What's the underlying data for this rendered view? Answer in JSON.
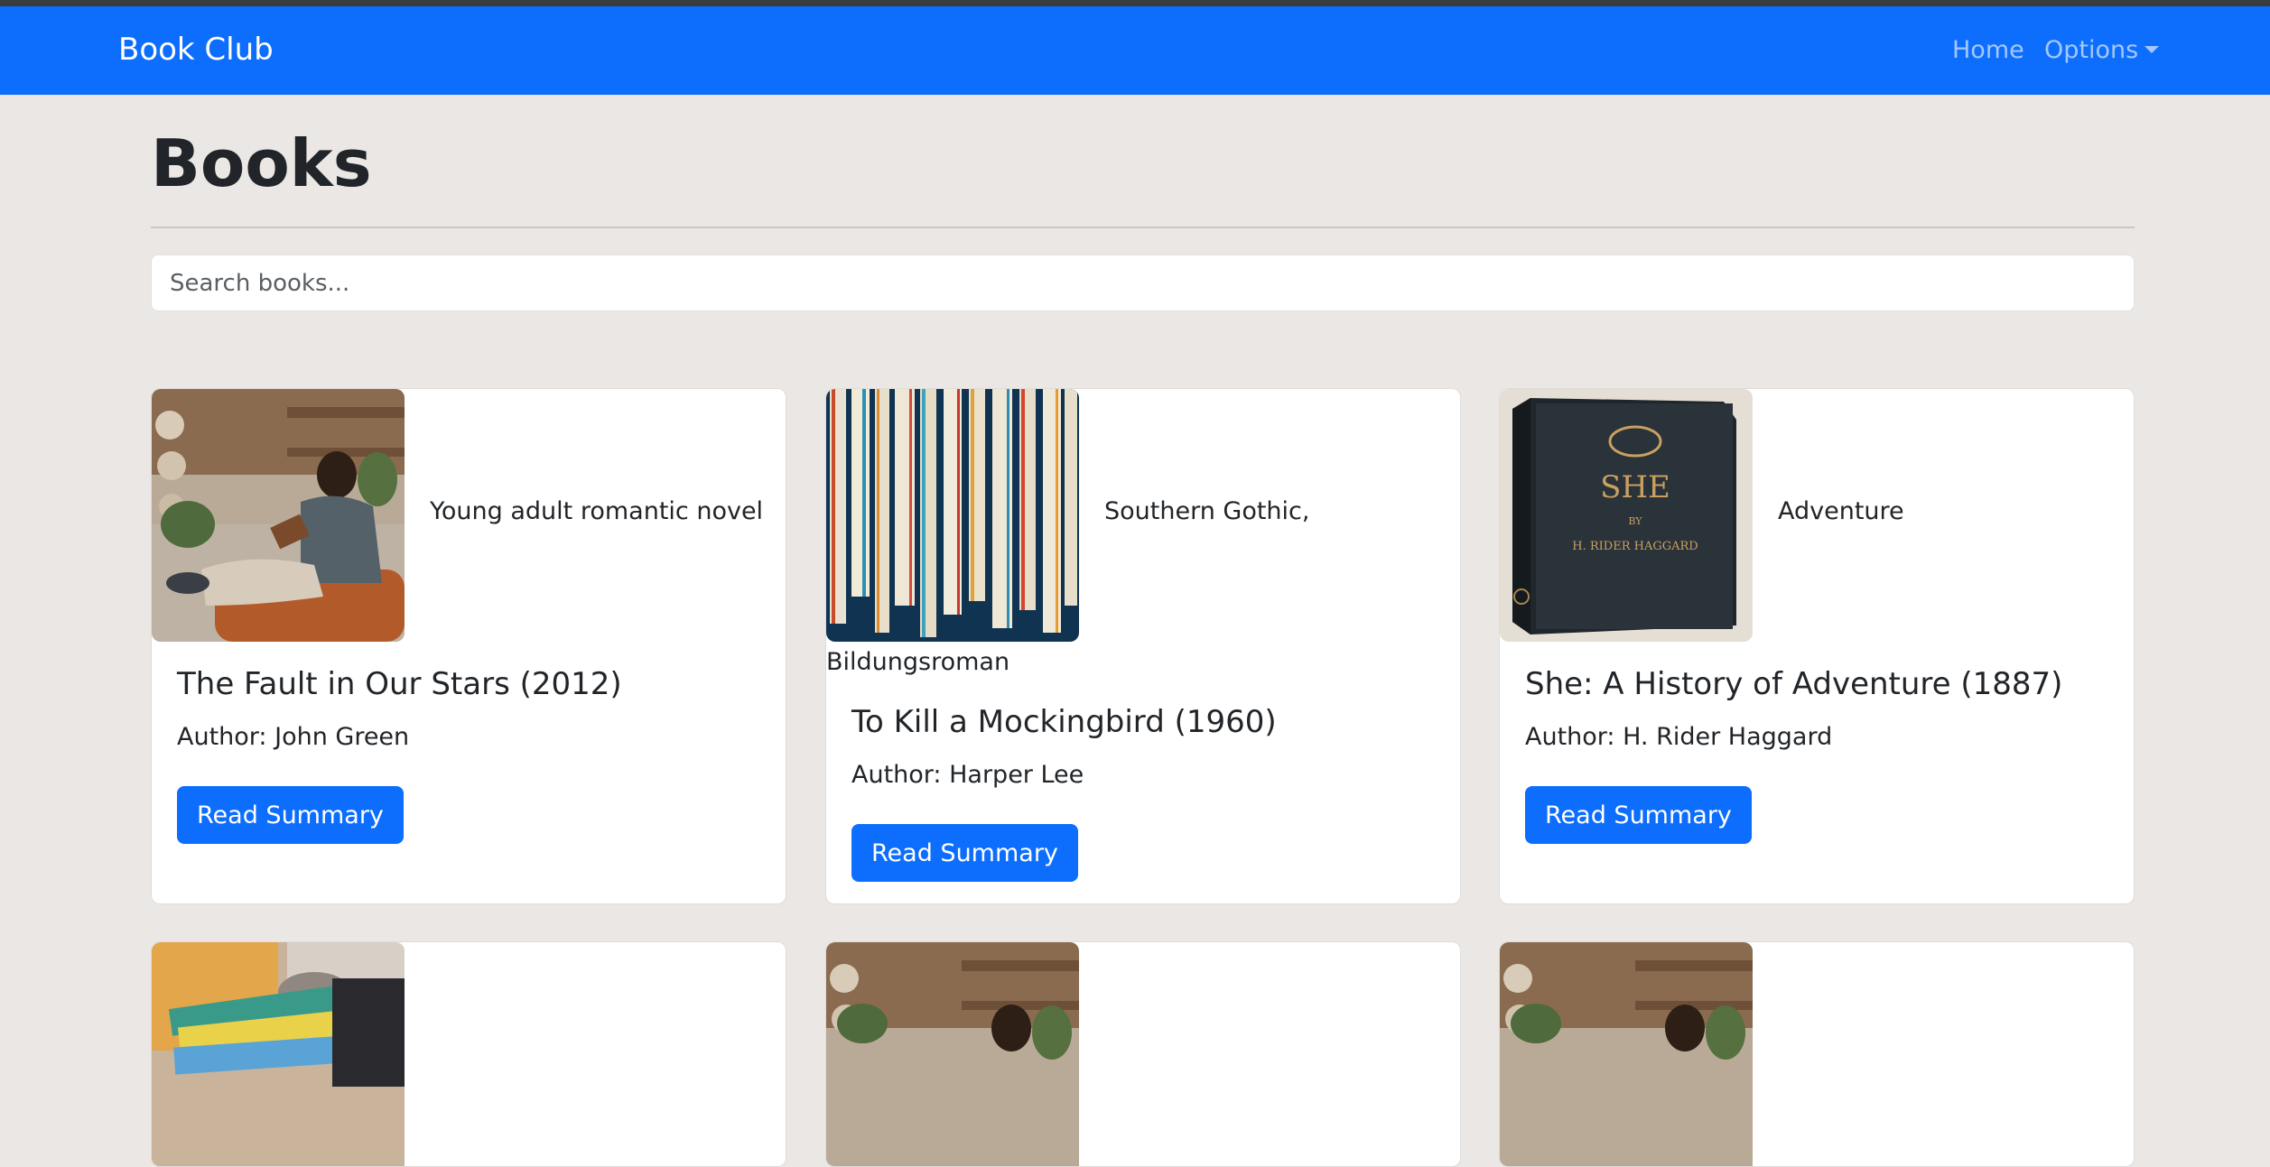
{
  "navbar": {
    "brand": "Book Club",
    "links": {
      "home": "Home",
      "options": "Options"
    }
  },
  "page": {
    "title": "Books",
    "search_placeholder": "Search books..."
  },
  "books": [
    {
      "genre": "Young adult romantic novel",
      "title": "The Fault in Our Stars (2012)",
      "author": "Author: John Green",
      "button": "Read Summary",
      "image": "man-reading-photo"
    },
    {
      "genre_line1": "Southern Gothic,",
      "genre_line2": "Bildungsroman",
      "title": "To Kill a Mockingbird (1960)",
      "author": "Author: Harper Lee",
      "button": "Read Summary",
      "image": "book-spines-photo"
    },
    {
      "genre": "Adventure",
      "title": "She: A History of Adventure (1887)",
      "author": "Author: H. Rider Haggard",
      "button": "Read Summary",
      "image": "she-book-cover-photo",
      "cover_text": [
        "SHE",
        "BY",
        "H. RIDER HAGGARD"
      ]
    },
    {
      "image": "stack-of-books-photo"
    },
    {
      "image": "man-reading-photo"
    },
    {
      "image": "man-reading-photo"
    }
  ],
  "colors": {
    "primary": "#0d6efd",
    "background": "#ebe7e4",
    "card": "#ffffff",
    "top_strip": "#3a3d40"
  }
}
